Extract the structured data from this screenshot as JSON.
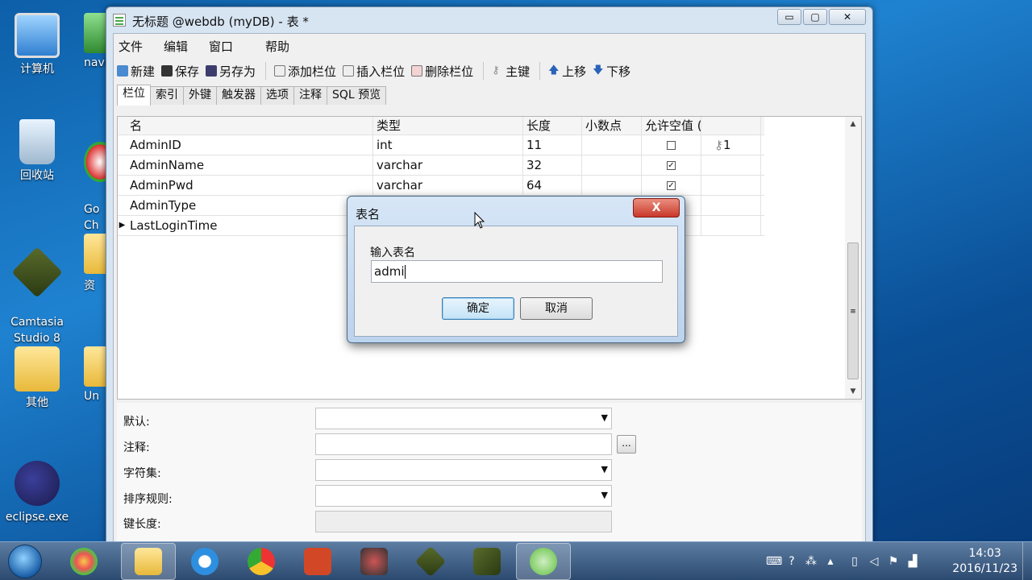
{
  "desktop": {
    "icons": [
      {
        "label": "计算机"
      },
      {
        "label": "回收站"
      },
      {
        "label": "Camtasia\nStudio 8"
      },
      {
        "label": "其他"
      },
      {
        "label": "eclipse.exe"
      }
    ],
    "partial_icons": [
      "navi",
      "Go\nCh",
      "资",
      "Un"
    ]
  },
  "window": {
    "title": "无标题 @webdb (myDB) - 表 *",
    "controls": {
      "minimize": "▭",
      "maximize": "▢",
      "close": "✕"
    },
    "menu": [
      "文件",
      "编辑",
      "窗口",
      "帮助"
    ],
    "toolbar": {
      "new": "新建",
      "save": "保存",
      "save_as": "另存为",
      "add_field": "添加栏位",
      "insert_field": "插入栏位",
      "delete_field": "删除栏位",
      "primary_key": "主键",
      "move_up": "上移",
      "move_down": "下移"
    },
    "tabs": [
      "栏位",
      "索引",
      "外键",
      "触发器",
      "选项",
      "注释",
      "SQL 预览"
    ],
    "grid": {
      "headers": [
        "名",
        "类型",
        "长度",
        "小数点",
        "允许空值 (",
        ""
      ],
      "rows": [
        {
          "name": "AdminID",
          "type": "int",
          "length": "11",
          "decimals": "",
          "null_checked": false,
          "key": "1"
        },
        {
          "name": "AdminName",
          "type": "varchar",
          "length": "32",
          "decimals": "",
          "null_checked": true,
          "key": ""
        },
        {
          "name": "AdminPwd",
          "type": "varchar",
          "length": "64",
          "decimals": "",
          "null_checked": true,
          "key": ""
        },
        {
          "name": "AdminType",
          "type": "",
          "length": "",
          "decimals": "",
          "null_checked": null,
          "key": ""
        },
        {
          "name": "LastLoginTime",
          "type": "",
          "length": "",
          "decimals": "",
          "null_checked": null,
          "key": "",
          "current": true
        }
      ]
    },
    "properties": {
      "default_label": "默认:",
      "comment_label": "注释:",
      "comment_button": "...",
      "charset_label": "字符集:",
      "collation_label": "排序规则:",
      "key_length_label": "键长度:"
    }
  },
  "dialog": {
    "title": "表名",
    "close": "X",
    "prompt": "输入表名",
    "input_value": "admi",
    "ok": "确定",
    "cancel": "取消"
  },
  "taskbar": {
    "time": "14:03",
    "date": "2016/11/23"
  }
}
